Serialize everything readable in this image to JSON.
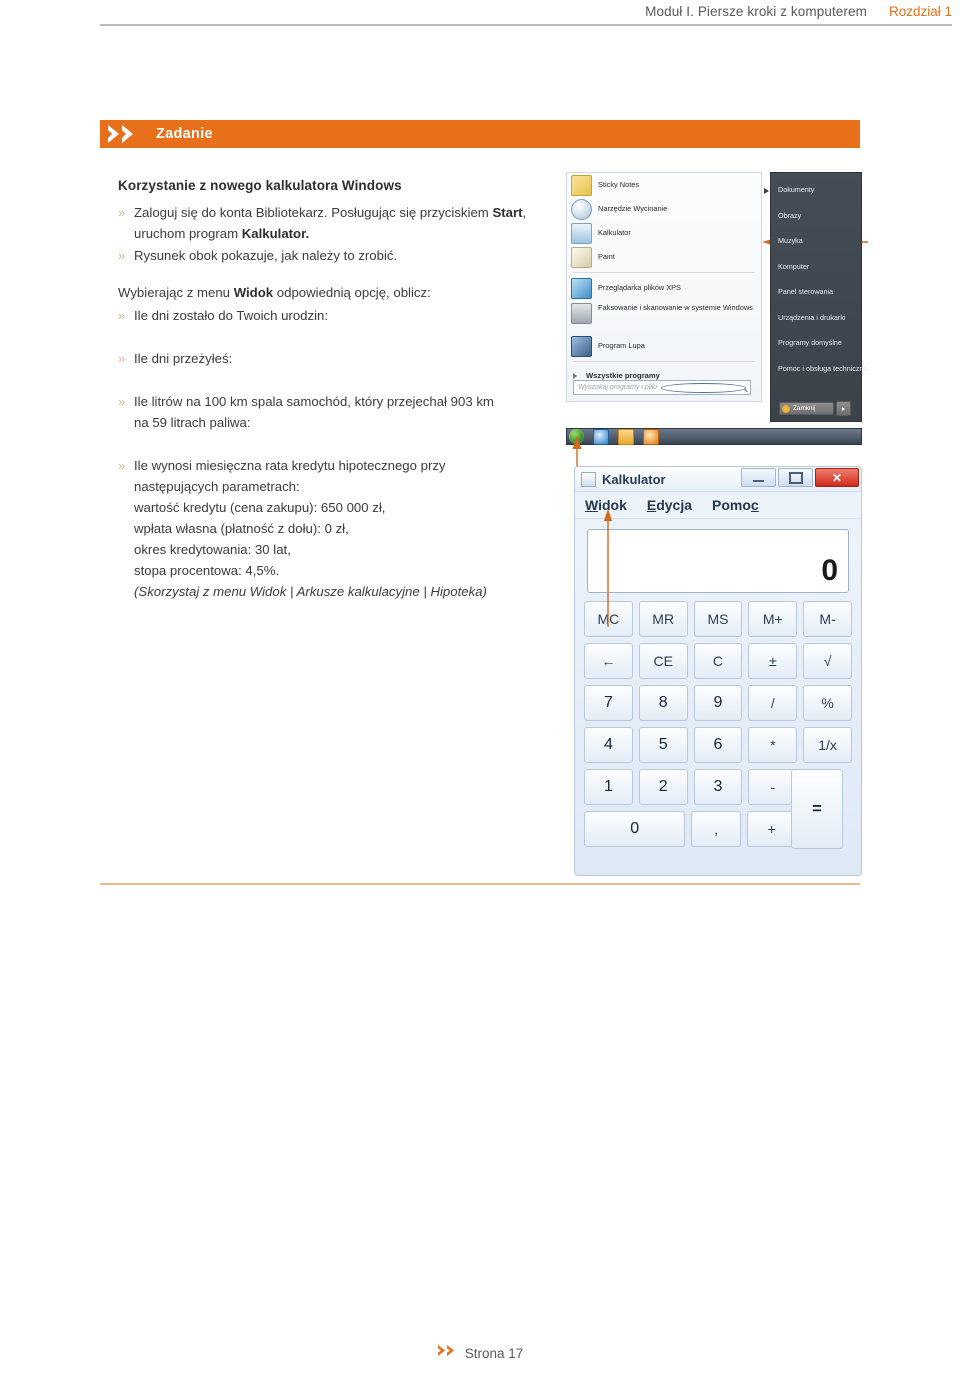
{
  "header": {
    "module": "Moduł I. Piersze kroki z komputerem",
    "chapter": "Rozdział 1"
  },
  "banner": {
    "title": "Zadanie",
    "icon": "double-chevron-right-icon",
    "color": "#e8701a"
  },
  "task": {
    "heading": "Korzystanie z nowego kalkulatora Windows",
    "bullet_mark": "»",
    "items": [
      {
        "segments": [
          {
            "text": "Zaloguj się do konta Bibliotekarz. Posługując się przyciskiem ",
            "style": "normal"
          },
          {
            "text": "Start",
            "style": "bold"
          },
          {
            "text": ", uruchom program ",
            "style": "normal"
          },
          {
            "text": "Kalkulator.",
            "style": "bold"
          }
        ]
      },
      {
        "segments": [
          {
            "text": "Rysunek obok pokazuje, jak należy to zrobić.",
            "style": "normal"
          }
        ]
      }
    ],
    "lead_in": {
      "segments": [
        {
          "text": "Wybierając z menu ",
          "style": "normal"
        },
        {
          "text": "Widok",
          "style": "bold"
        },
        {
          "text": " odpowiednią opcję, oblicz:",
          "style": "normal"
        }
      ]
    },
    "questions": [
      {
        "lines": [
          "Ile dni zostało do Twoich urodzin:"
        ],
        "answer_lines": 1
      },
      {
        "lines": [
          "Ile dni przeżyłeś:"
        ],
        "answer_lines": 1
      },
      {
        "lines": [
          "Ile litrów na 100 km spala samochód, który przejechał 903 km",
          "na 59 litrach paliwa:"
        ],
        "answer_lines": 1
      },
      {
        "lines": [
          "Ile wynosi miesięczna rata kredytu hipotecznego przy",
          "następujących parametrach:",
          "wartość kredytu (cena zakupu): 650 000 zł,",
          "wpłata własna (płatność z dołu): 0 zł,",
          "okres kredytowania: 30 lat,",
          "stopa procentowa: 4,5%."
        ],
        "hint": "(Skorzystaj z menu Widok | Arkusze kalkulacyjne | Hipoteka)",
        "answer_lines": 9
      }
    ]
  },
  "start_menu": {
    "programs": [
      {
        "label": "Sticky Notes",
        "icon": "sticky-notes-icon",
        "color": "#f2d06b"
      },
      {
        "label": "Narzędzie Wycinanie",
        "icon": "snipping-tool-icon",
        "color": "#cfd9e6"
      },
      {
        "label": "Kalkulator",
        "icon": "calculator-icon",
        "color": "#bcd6ea"
      },
      {
        "label": "Paint",
        "icon": "paint-icon",
        "color": "#e8e3d5"
      },
      {
        "label": "Przeglądarka plików XPS",
        "icon": "xps-viewer-icon",
        "color": "#79b8e0"
      },
      {
        "label": "Faksowanie i skanowanie w systemie Windows",
        "icon": "fax-scan-icon",
        "color": "#c3c8cc"
      },
      {
        "label": "Program Lupa",
        "icon": "magnifier-icon",
        "color": "#6f8fb5"
      }
    ],
    "all_programs": "Wszystkie programy",
    "search_placeholder": "Wyszukaj programy i pliki",
    "search_icon": "magnifier-icon",
    "right_items": [
      "Dokumenty",
      "Obrazy",
      "Muzyka",
      "Komputer",
      "Panel sterowania",
      "Urządzenia i drukarki",
      "Programy domyślne",
      "Pomoc i obsługa techniczna"
    ],
    "shutdown_label": "Zamknij",
    "panel_color": "#3f4750",
    "callout_color": "#d2691e"
  },
  "calculator": {
    "window_title": "Kalkulator",
    "window_icon": "calculator-icon",
    "window_buttons": {
      "minimize": "minimize-icon",
      "maximize": "maximize-icon",
      "close": "✕"
    },
    "menus": [
      {
        "prefix": "",
        "accel": "W",
        "suffix": "idok"
      },
      {
        "prefix": "",
        "accel": "E",
        "suffix": "dycja"
      },
      {
        "prefix": "Pomo",
        "accel": "c",
        "suffix": ""
      }
    ],
    "display_value": "0",
    "memory_row": [
      "MC",
      "MR",
      "MS",
      "M+",
      "M-"
    ],
    "edit_row": [
      "←",
      "CE",
      "C",
      "±",
      "√"
    ],
    "keys": [
      [
        "7",
        "8",
        "9",
        "/",
        "%"
      ],
      [
        "4",
        "5",
        "6",
        "*",
        "1/x"
      ],
      [
        "1",
        "2",
        "3",
        "-"
      ],
      [
        "0",
        ",",
        "+"
      ]
    ],
    "equals": "="
  },
  "footer": {
    "icon": "double-chevron-right-icon",
    "text": "Strona 17"
  }
}
